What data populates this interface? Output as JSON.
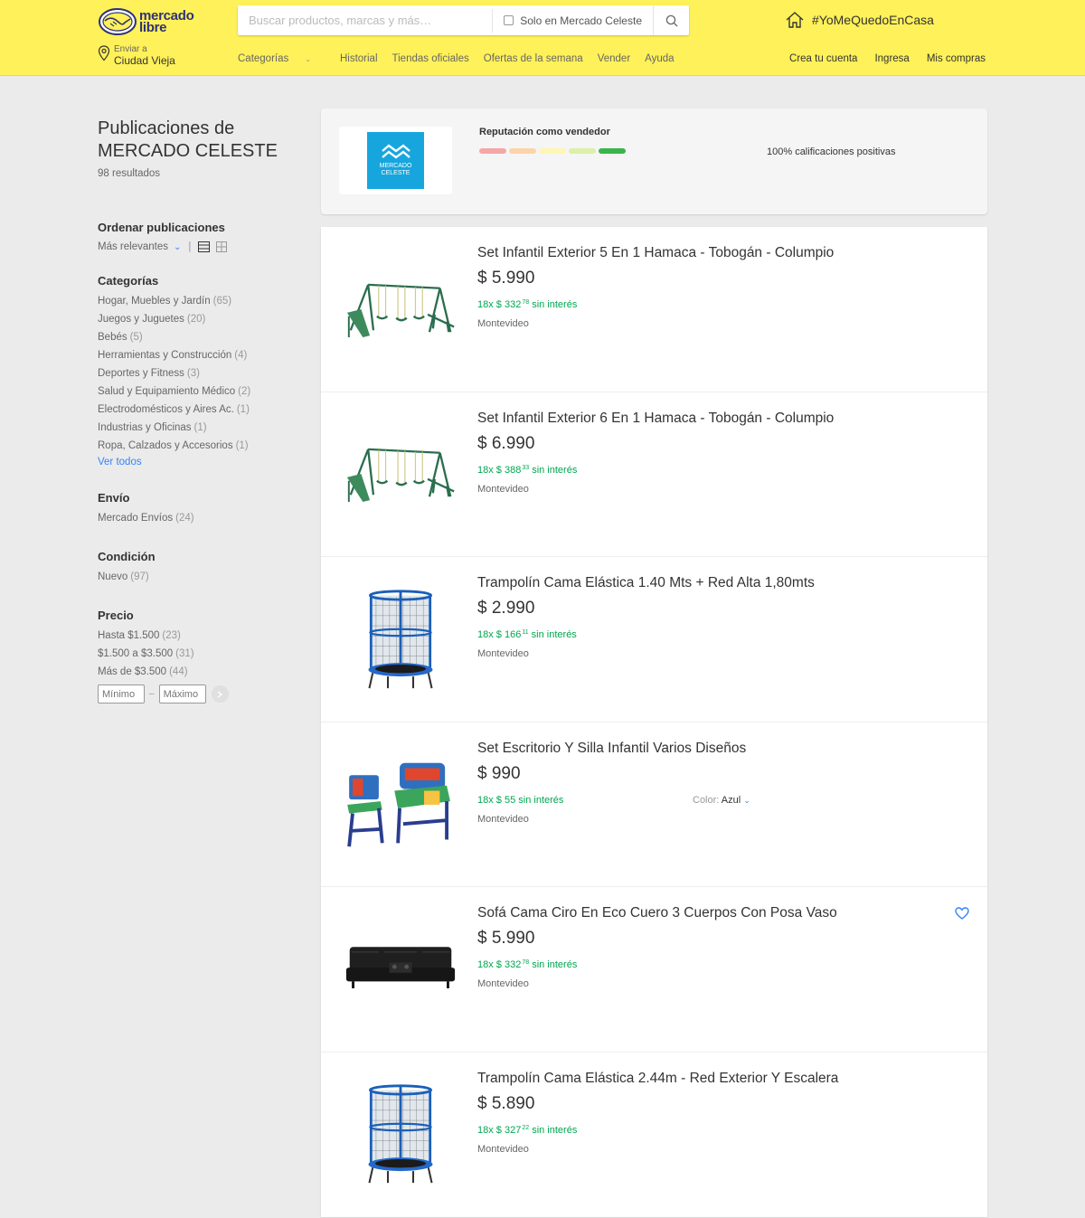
{
  "header": {
    "logo_line1": "mercado",
    "logo_line2": "libre",
    "search_placeholder": "Buscar productos, marcas y más…",
    "search_filter_label": "Solo en Mercado Celeste",
    "promo": "#YoMeQuedoEnCasa",
    "ship_to_label": "Enviar a",
    "ship_to_city": "Ciudad Vieja",
    "nav": [
      "Categorías",
      "Historial",
      "Tiendas oficiales",
      "Ofertas de la semana",
      "Vender",
      "Ayuda"
    ],
    "account": [
      "Crea tu cuenta",
      "Ingresa",
      "Mis compras"
    ],
    "brand_color": "#fff159"
  },
  "sidebar": {
    "title_line1": "Publicaciones de",
    "title_line2": "MERCADO CELESTE",
    "results": "98 resultados",
    "sort": {
      "heading": "Ordenar publicaciones",
      "value": "Más relevantes"
    },
    "categories": {
      "heading": "Categorías",
      "items": [
        {
          "label": "Hogar, Muebles y Jardín",
          "count": "(65)"
        },
        {
          "label": "Juegos y Juguetes",
          "count": "(20)"
        },
        {
          "label": "Bebés",
          "count": "(5)"
        },
        {
          "label": "Herramientas y Construcción",
          "count": "(4)"
        },
        {
          "label": "Deportes y Fitness",
          "count": "(3)"
        },
        {
          "label": "Salud y Equipamiento Médico",
          "count": "(2)"
        },
        {
          "label": "Electrodomésticos y Aires Ac.",
          "count": "(1)"
        },
        {
          "label": "Industrias y Oficinas",
          "count": "(1)"
        },
        {
          "label": "Ropa, Calzados y Accesorios",
          "count": "(1)"
        }
      ],
      "see_all": "Ver todos"
    },
    "shipping": {
      "heading": "Envío",
      "items": [
        {
          "label": "Mercado Envíos",
          "count": "(24)"
        }
      ]
    },
    "condition": {
      "heading": "Condición",
      "items": [
        {
          "label": "Nuevo",
          "count": "(97)"
        }
      ]
    },
    "price": {
      "heading": "Precio",
      "items": [
        {
          "label": "Hasta $1.500",
          "count": "(23)"
        },
        {
          "label": "$1.500 a $3.500",
          "count": "(31)"
        },
        {
          "label": "Más de $3.500",
          "count": "(44)"
        }
      ],
      "min_placeholder": "Mínimo",
      "max_placeholder": "Máximo",
      "dash": "–"
    }
  },
  "seller": {
    "logo_text_line1": "MERCADO",
    "logo_text_line2": "CELESTE",
    "reputation_title": "Reputación como vendedor",
    "reputation_colors": [
      "#f4a7a6",
      "#fbd4a9",
      "#fff6b3",
      "#dcf0a9",
      "#39b54a"
    ],
    "positive": "100% calificaciones positivas"
  },
  "results": [
    {
      "title": "Set Infantil Exterior 5 En 1 Hamaca - Tobogán - Columpio",
      "price": "$ 5.990",
      "inst_prefix": "18x $ 332",
      "inst_cents": "78",
      "inst_suffix": "sin interés",
      "location": "Montevideo",
      "image": "swing-set-icon"
    },
    {
      "title": "Set Infantil Exterior 6 En 1 Hamaca - Tobogán - Columpio",
      "price": "$ 6.990",
      "inst_prefix": "18x $ 388",
      "inst_cents": "33",
      "inst_suffix": "sin interés",
      "location": "Montevideo",
      "image": "swing-set-icon"
    },
    {
      "title": "Trampolín Cama Elástica 1.40 Mts + Red Alta 1,80mts",
      "price": "$ 2.990",
      "inst_prefix": "18x $ 166",
      "inst_cents": "11",
      "inst_suffix": "sin interés",
      "location": "Montevideo",
      "image": "trampoline-icon"
    },
    {
      "title": "Set Escritorio Y Silla Infantil Varios Diseños",
      "price": "$ 990",
      "inst_prefix": "18x $ 55",
      "inst_cents": "",
      "inst_suffix": "sin interés",
      "location": "Montevideo",
      "image": "desk-chair-icon",
      "color_label": "Color:",
      "color_value": "Azul"
    },
    {
      "title": "Sofá Cama Ciro En Eco Cuero 3 Cuerpos Con Posa Vaso",
      "price": "$ 5.990",
      "inst_prefix": "18x $ 332",
      "inst_cents": "78",
      "inst_suffix": "sin interés",
      "location": "Montevideo",
      "image": "sofa-icon"
    },
    {
      "title": "Trampolín Cama Elástica 2.44m - Red Exterior Y Escalera",
      "price": "$ 5.890",
      "inst_prefix": "18x $ 327",
      "inst_cents": "22",
      "inst_suffix": "sin interés",
      "location": "Montevideo",
      "image": "trampoline-icon"
    }
  ]
}
